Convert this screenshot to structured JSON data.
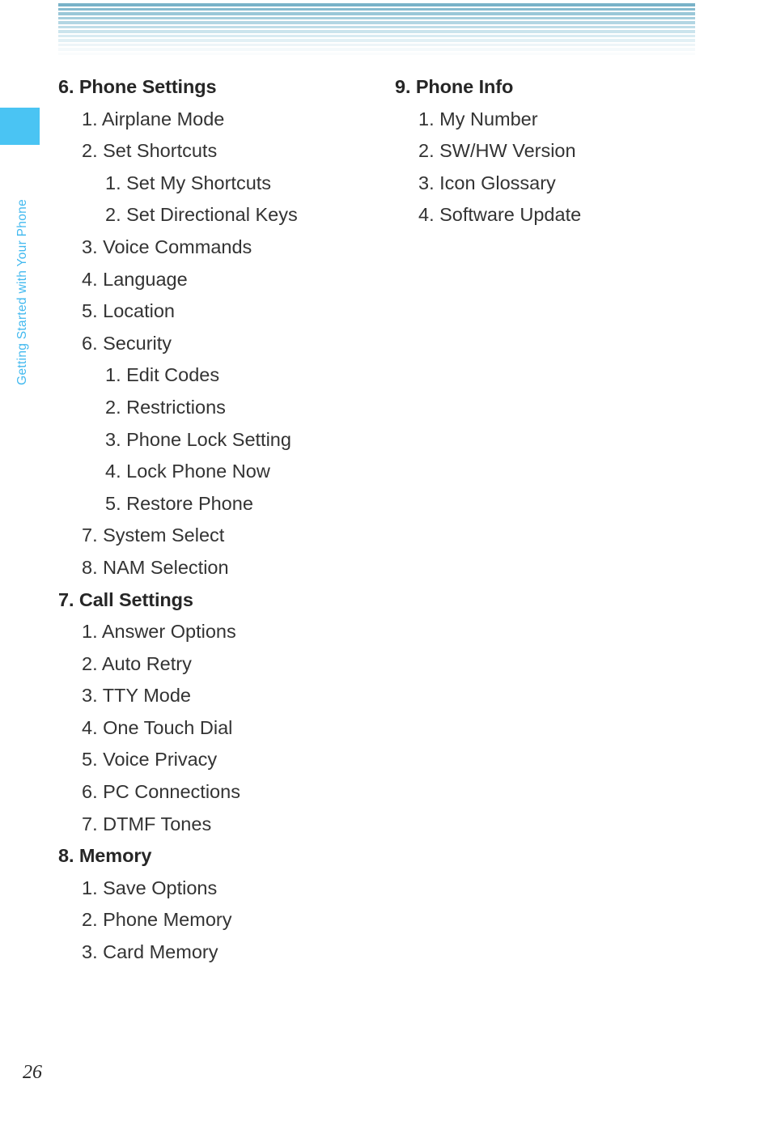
{
  "page": {
    "number": "26",
    "background_color": "#ffffff",
    "text_color": "#333333"
  },
  "chapter_tab": {
    "label": "Getting Started with Your Phone",
    "tab_color": "#4ac4f3",
    "label_color": "#42b9ef"
  },
  "header_band": {
    "stripe_colors": [
      "#79b2c8",
      "#86bbcf",
      "#9ac7d8",
      "#a6cedd",
      "#b3d6e3",
      "#bfdde8",
      "#cbe4ed",
      "#d8ebf2",
      "#e2f0f5",
      "#edf5f8",
      "#f4f9fb",
      "#fafcfd"
    ],
    "stripe_height": 3.5,
    "stripe_gap": 2.0
  },
  "columns": {
    "left": [
      {
        "level": 1,
        "text": "6. Phone Settings"
      },
      {
        "level": 2,
        "text": "1. Airplane Mode"
      },
      {
        "level": 2,
        "text": "2. Set Shortcuts"
      },
      {
        "level": 3,
        "text": "1. Set My Shortcuts"
      },
      {
        "level": 3,
        "text": "2. Set Directional Keys"
      },
      {
        "level": 2,
        "text": "3. Voice Commands"
      },
      {
        "level": 2,
        "text": "4. Language"
      },
      {
        "level": 2,
        "text": "5. Location"
      },
      {
        "level": 2,
        "text": "6. Security"
      },
      {
        "level": 3,
        "text": "1. Edit Codes"
      },
      {
        "level": 3,
        "text": "2. Restrictions"
      },
      {
        "level": 3,
        "text": "3. Phone Lock Setting"
      },
      {
        "level": 3,
        "text": "4. Lock Phone Now"
      },
      {
        "level": 3,
        "text": "5. Restore Phone"
      },
      {
        "level": 2,
        "text": "7. System Select"
      },
      {
        "level": 2,
        "text": "8. NAM Selection"
      },
      {
        "level": 1,
        "text": "7. Call Settings"
      },
      {
        "level": 2,
        "text": "1. Answer Options"
      },
      {
        "level": 2,
        "text": "2. Auto Retry"
      },
      {
        "level": 2,
        "text": "3. TTY Mode"
      },
      {
        "level": 2,
        "text": "4. One Touch Dial"
      },
      {
        "level": 2,
        "text": "5. Voice Privacy"
      },
      {
        "level": 2,
        "text": "6. PC Connections"
      },
      {
        "level": 2,
        "text": "7. DTMF Tones"
      },
      {
        "level": 1,
        "text": "8. Memory"
      },
      {
        "level": 2,
        "text": "1. Save Options"
      },
      {
        "level": 2,
        "text": "2. Phone Memory"
      },
      {
        "level": 2,
        "text": "3. Card Memory"
      }
    ],
    "right": [
      {
        "level": 1,
        "text": "9. Phone Info"
      },
      {
        "level": 2,
        "text": "1. My Number"
      },
      {
        "level": 2,
        "text": "2. SW/HW Version"
      },
      {
        "level": 2,
        "text": "3. Icon Glossary"
      },
      {
        "level": 2,
        "text": "4. Software Update"
      }
    ]
  }
}
